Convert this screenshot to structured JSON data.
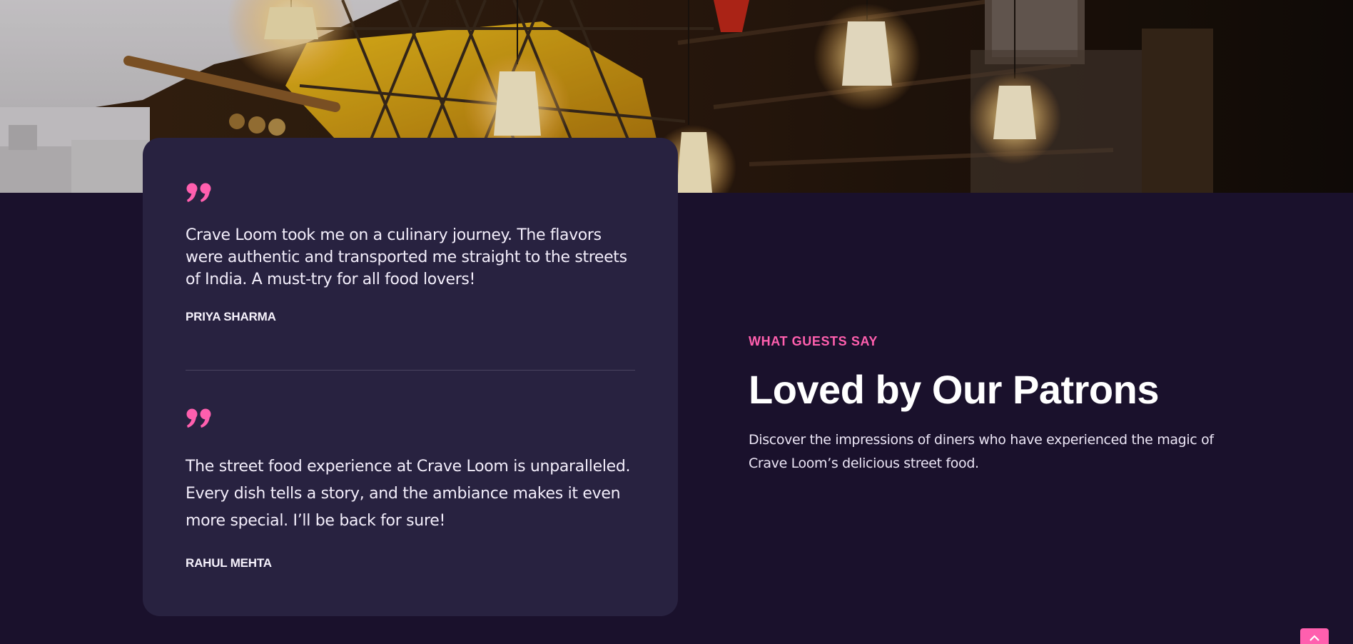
{
  "testimonials": [
    {
      "quote_icon": "quote-icon",
      "text": "Crave Loom took me on a culinary journey. The flavors were authentic and transported me straight to the streets of India. A must-try for all food lovers!",
      "author": "PRIYA SHARMA"
    },
    {
      "quote_icon": "quote-icon",
      "text": "The street food experience at Crave Loom is unparalleled. Every dish tells a story, and the ambiance makes it even more special. I’ll be back for sure!",
      "author": "RAHUL MEHTA"
    }
  ],
  "intro": {
    "eyebrow": "WHAT GUESTS SAY",
    "heading": "Loved by Our Patrons",
    "description": "Discover the impressions of diners who have experienced the magic of Crave Loom’s delicious street food."
  },
  "back_to_top": {
    "icon": "chevron-up-icon"
  },
  "colors": {
    "accent": "#ff5fae",
    "page_background": "#1a112c",
    "card_background": "#282240",
    "text": "#ffffff"
  }
}
